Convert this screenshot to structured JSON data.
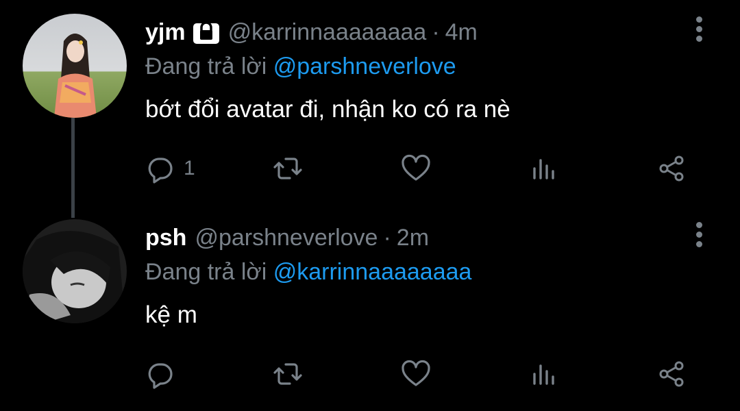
{
  "tweets": [
    {
      "name": "yjm",
      "handle": "@karrinnaaaaaaaa",
      "separator": "·",
      "time": "4m",
      "reply_prefix": "Đang trả lời",
      "reply_to": "@parshneverlove",
      "text": "bớt đổi avatar đi, nhận ko có ra nè",
      "reply_count": "1",
      "locked": true
    },
    {
      "name": "psh",
      "handle": "@parshneverlove",
      "separator": "·",
      "time": "2m",
      "reply_prefix": "Đang trả lời",
      "reply_to": "@karrinnaaaaaaaa",
      "text": "kệ m",
      "reply_count": "",
      "locked": false
    }
  ],
  "colors": {
    "background": "#000000",
    "muted": "#7a828a",
    "accent": "#1d9bf0",
    "text": "#ffffff"
  },
  "icons": [
    "lock-icon",
    "more-vertical-icon",
    "reply-icon",
    "retweet-icon",
    "like-icon",
    "views-icon",
    "share-icon"
  ]
}
